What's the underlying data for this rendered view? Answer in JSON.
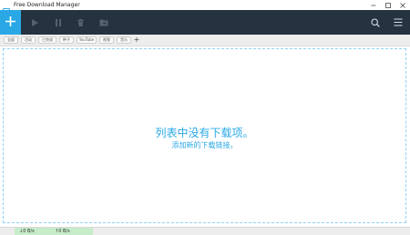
{
  "window": {
    "title": "Free Download Manager"
  },
  "toolbar": {
    "add_icon": "plus-icon",
    "play_icon": "play-icon",
    "pause_icon": "pause-icon",
    "delete_icon": "trash-icon",
    "move_icon": "folder-move-icon",
    "search_icon": "search-icon",
    "menu_icon": "hamburger-menu-icon"
  },
  "filters": {
    "items": [
      {
        "label": "全部"
      },
      {
        "label": "活动"
      },
      {
        "label": "已完成"
      },
      {
        "label": "种子"
      },
      {
        "label": "YouTube"
      },
      {
        "label": "视频"
      },
      {
        "label": "音乐"
      }
    ],
    "add_label": "+"
  },
  "empty_state": {
    "line1": "列表中没有下载项。",
    "line2": "添加新的下载链接。"
  },
  "status": {
    "download_speed": "↓0 B/s",
    "upload_speed": "↑0 B/s"
  },
  "colors": {
    "accent": "#2aa8e6",
    "toolbar_bg": "#253341",
    "speed_bg": "#c7ecc9"
  }
}
